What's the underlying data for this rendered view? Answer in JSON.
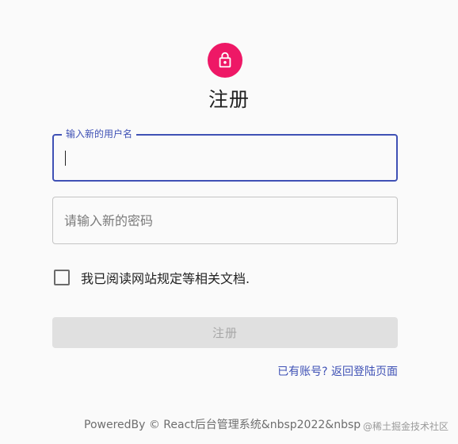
{
  "page": {
    "title": "注册"
  },
  "form": {
    "username": {
      "label": "输入新的用户名",
      "value": "",
      "placeholder": ""
    },
    "password": {
      "value": "",
      "placeholder": "请输入新的密码"
    },
    "agree_label": "我已阅读网站规定等相关文档.",
    "agree_checked": false,
    "submit_label": "注册",
    "login_link": "已有账号? 返回登陆页面"
  },
  "footer": {
    "text": "PoweredBy © React后台管理系统&nbsp2022&nbsp"
  },
  "watermark": {
    "text": "@稀土掘金技术社区"
  },
  "icons": {
    "avatar": "lock-icon"
  },
  "colors": {
    "accent": "#ee1866",
    "primary": "#3f51b5",
    "disabled_bg": "#e0e0e0",
    "disabled_text": "#a7a7a7"
  }
}
